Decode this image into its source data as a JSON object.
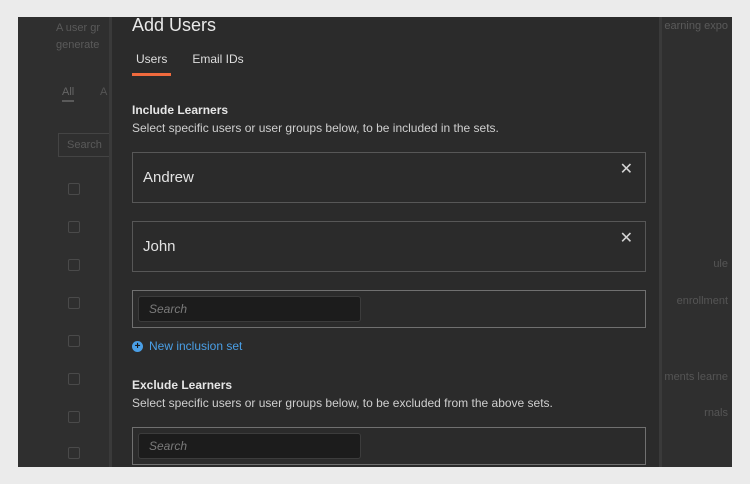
{
  "background_page": {
    "description_lines": [
      "A user gr",
      "generate"
    ],
    "description_right": "earning expo",
    "tabs": [
      "All",
      "A"
    ],
    "search_label": "Search",
    "right_texts": [
      "ule",
      "enrollment",
      "ments learne",
      "rnals"
    ]
  },
  "modal": {
    "title": "Add Users",
    "tabs": [
      {
        "label": "Users",
        "active": true
      },
      {
        "label": "Email IDs",
        "active": false
      }
    ],
    "include": {
      "title": "Include Learners",
      "subtitle": "Select specific users or user groups below, to be included in the sets.",
      "selected": [
        {
          "name": "Andrew",
          "remove_icon": "close-icon"
        },
        {
          "name": "John",
          "remove_icon": "close-icon"
        }
      ],
      "search_placeholder": "Search",
      "new_set_label": "New inclusion set",
      "new_set_icon": "plus-circle-icon"
    },
    "exclude": {
      "title": "Exclude Learners",
      "subtitle": "Select specific users or user groups below, to be excluded from the above sets.",
      "search_placeholder": "Search"
    }
  },
  "colors": {
    "accent": "#f06a3d",
    "link": "#4a9fe6",
    "modal_bg": "#2b2b2b",
    "outer_bg": "#ebebeb"
  }
}
